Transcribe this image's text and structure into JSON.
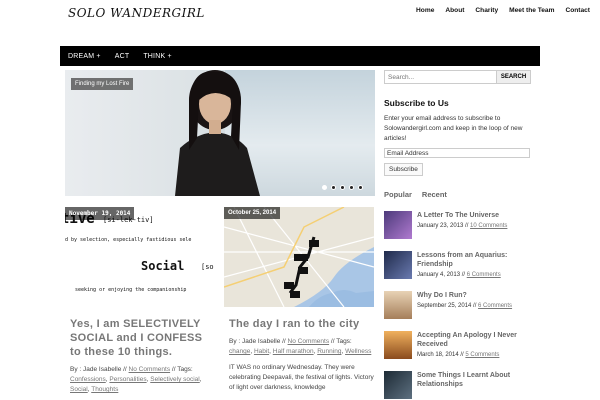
{
  "header": {
    "logo": "SOLO WANDERGIRL",
    "nav": [
      "Home",
      "About",
      "Charity",
      "Meet the Team",
      "Contact"
    ]
  },
  "mainnav": [
    "DREAM +",
    "ACT",
    "THINK +"
  ],
  "slider": {
    "caption": "Finding my Lost Fire",
    "dots": 5,
    "active_dot": 1
  },
  "posts": [
    {
      "date": "November 19, 2014",
      "dict": {
        "word": "tive",
        "phonetic": "[si-lek-tiv]",
        "line1": "d by selection, especially fastidious sele",
        "social": "Social",
        "social_tail": "[so",
        "line2": "seeking or enjoying the companionship"
      },
      "title": "Yes, I am SELECTIVELY SOCIAL and I CONFESS to these 10 things.",
      "by": "By : Jade Isabelle",
      "comments": "No Comments",
      "tags_label": "Tags:",
      "tags": [
        "Confessions",
        "Personalities",
        "Selectively social",
        "Social",
        "Thoughts"
      ]
    },
    {
      "date": "October 25, 2014",
      "title": "The day I ran to the city",
      "by": "By : Jade Isabelle",
      "comments": "No Comments",
      "tags_label": "Tags:",
      "tags": [
        "change",
        "Habit",
        "Half marathon",
        "Running",
        "Wellness"
      ],
      "excerpt": "IT WAS no ordinary Wednesday. They were celebrating Deepavali, the festival of lights. Victory of light over darkness, knowledge"
    }
  ],
  "sidebar": {
    "search_placeholder": "Search...",
    "search_button": "SEARCH",
    "subscribe_title": "Subscribe to Us",
    "subscribe_text": "Enter your email address to subscribe to Solowandergirl.com and keep in the loop of new articles!",
    "email_placeholder": "Email Address",
    "subscribe_button": "Subscribe",
    "tabs": [
      "Popular",
      "Recent"
    ],
    "items": [
      {
        "title": "A Letter To The Universe",
        "date": "January 23, 2013",
        "comments": "10 Comments",
        "color": "#7d5f9e"
      },
      {
        "title": "Lessons from an Aquarius: Friendship",
        "date": "January 4, 2013",
        "comments": "6 Comments",
        "color": "#3d4a6e"
      },
      {
        "title": "Why Do I Run?",
        "date": "September 25, 2014",
        "comments": "6 Comments",
        "color": "#c9a985"
      },
      {
        "title": "Accepting An Apology I Never Received",
        "date": "March 18, 2014",
        "comments": "5 Comments",
        "color": "#d68a3c"
      },
      {
        "title": "Some Things I Learnt About Relationships",
        "date": "",
        "comments": "",
        "color": "#2f3f4c"
      }
    ]
  }
}
